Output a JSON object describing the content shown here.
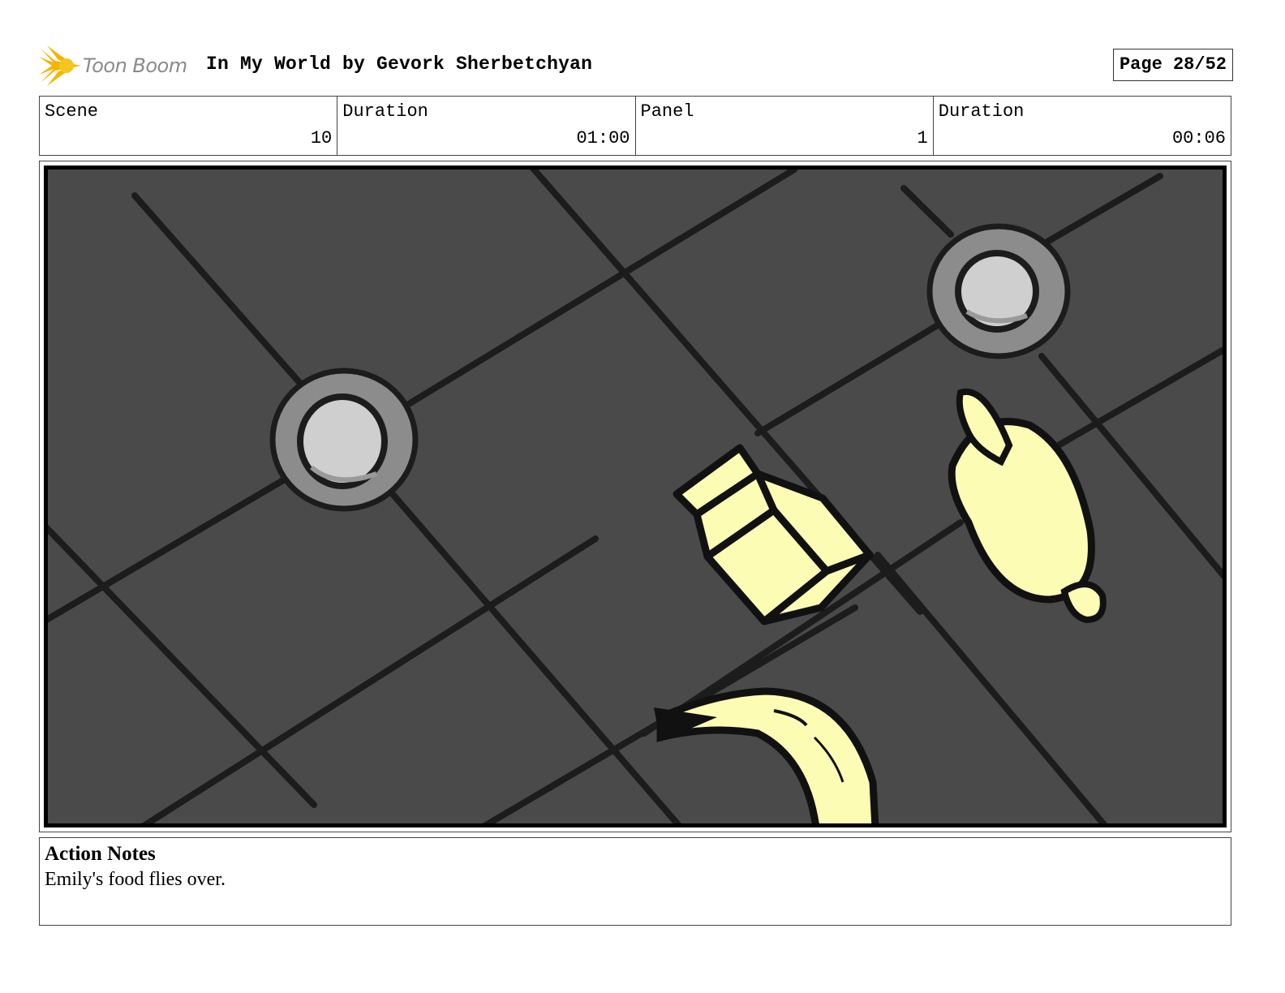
{
  "header": {
    "logo_text": "Toon Boom",
    "title": "In My World by Gevork Sherbetchyan",
    "page": "Page 28/52"
  },
  "info": {
    "scene_label": "Scene",
    "scene_value": "10",
    "scene_duration_label": "Duration",
    "scene_duration_value": "01:00",
    "panel_label": "Panel",
    "panel_value": "1",
    "panel_duration_label": "Duration",
    "panel_duration_value": "00:06"
  },
  "notes": {
    "title": "Action Notes",
    "text": "Emily's food flies over."
  },
  "colors": {
    "floor": "#4a4a4a",
    "grout": "#1c1c1c",
    "food": "#fdfcb4",
    "plate_rim": "#8c8c8c",
    "plate_center": "#cfcfcf",
    "logo_star": "#f5b400"
  }
}
